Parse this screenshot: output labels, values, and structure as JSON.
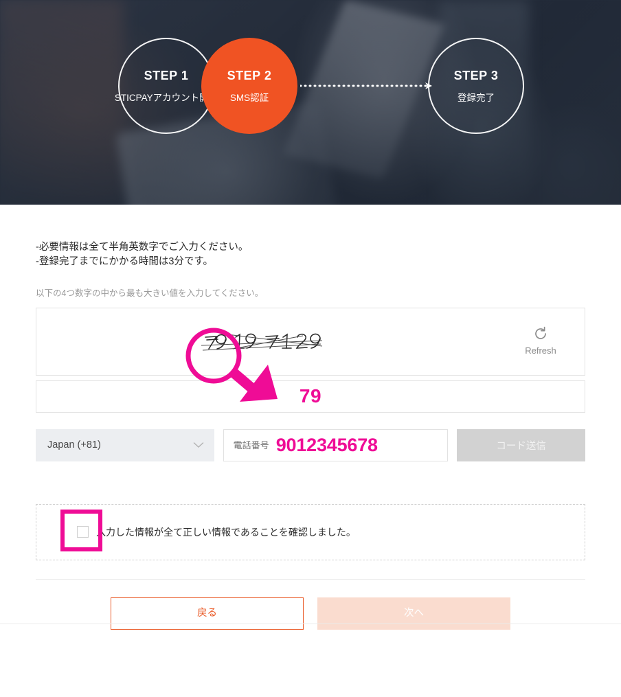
{
  "colors": {
    "accent_orange": "#f05323",
    "annotation_magenta": "#ef0c96",
    "hero_dark": "#2b3442",
    "disabled_gray": "#d2d2d2",
    "next_disabled": "#fadccf",
    "back_border": "#ea5b28"
  },
  "hero": {
    "steps": [
      {
        "title": "STEP 1",
        "subtitle": "STICPAYアカウント開設",
        "state": "inactive"
      },
      {
        "title": "STEP 2",
        "subtitle": "SMS認証",
        "state": "active"
      },
      {
        "title": "STEP 3",
        "subtitle": "登録完了",
        "state": "inactive"
      }
    ]
  },
  "notice": {
    "line1": "-必要情報は全て半角英数字でご入力ください。",
    "line2": "-登録完了までにかかる時間は3分です。"
  },
  "captcha": {
    "hint": "以下の4つ数字の中から最も大きい値を入力してください。",
    "numbers": [
      "79",
      "19",
      "71",
      "29"
    ],
    "largest": "79",
    "refresh_label": "Refresh",
    "refresh_icon": "refresh-icon",
    "answer_value": "79"
  },
  "phone": {
    "country_value": "Japan (+81)",
    "country_icon": "chevron-down-icon",
    "number_label": "電話番号",
    "number_value": "9012345678",
    "number_placeholder": "電話番号",
    "send_code_label": "コード送信",
    "send_code_disabled": true
  },
  "agreement": {
    "checkbox_checked": false,
    "label": "入力した情報が全て正しい情報であることを確認しました。"
  },
  "actions": {
    "back_label": "戻る",
    "next_label": "次へ",
    "next_disabled": true
  }
}
